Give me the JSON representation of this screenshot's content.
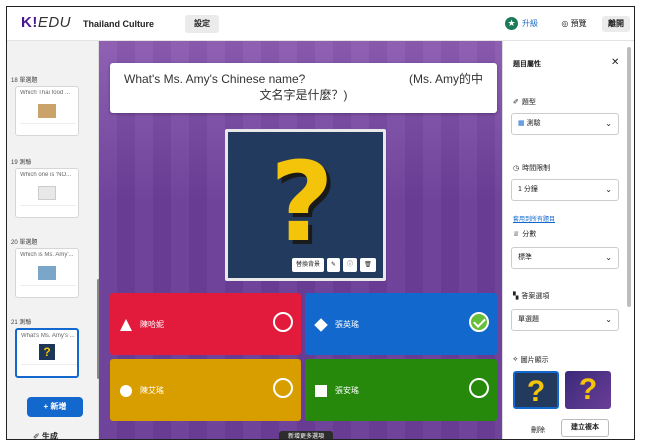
{
  "header": {
    "logo_main": "K!",
    "logo_sub": "EDU",
    "title": "Thailand Culture",
    "settings_label": "設定",
    "upgrade_label": "升級",
    "preview_label": "◎ 預覽",
    "exit_label": "離開"
  },
  "slides": [
    {
      "label": "18 單選題",
      "question": "Which Thai food ..."
    },
    {
      "label": "19 測驗",
      "question": "Which one is 'NO..."
    },
    {
      "label": "20 單選題",
      "question": "Which is Ms. Amy'..."
    },
    {
      "label": "21 測驗",
      "question": "What's Ms. Amy's ..."
    }
  ],
  "left": {
    "add_label": "+ 新增",
    "generate_label": "✐ 生成"
  },
  "question": {
    "line1": "What's Ms. Amy's Chinese name?",
    "right": "(Ms. Amy的中",
    "line2": "文名字是什麼？)"
  },
  "media": {
    "replace_label": "替換背景"
  },
  "answers": [
    {
      "text": "陳哈妮",
      "correct": false
    },
    {
      "text": "張英瑤",
      "correct": true
    },
    {
      "text": "陳艾瑤",
      "correct": false
    },
    {
      "text": "張安瑤",
      "correct": false
    }
  ],
  "canvas": {
    "bottom_tag": "新增更多選項"
  },
  "right": {
    "title": "題目屬性",
    "type_label": "題型",
    "type_value": "測驗",
    "time_label": "時間限制",
    "time_value": "1 分鐘",
    "link_label": "套用到所有題目",
    "points_label": "分數",
    "points_value": "標準",
    "answer_label": "答案選項",
    "answer_value": "單選題",
    "image_label": "圖片顯示",
    "delete_label": "刪除",
    "duplicate_label": "建立複本"
  },
  "colors": {
    "red": "#e21b3c",
    "blue": "#1368ce",
    "yellow": "#d89e00",
    "green": "#26890c",
    "purple": "#46178f"
  }
}
